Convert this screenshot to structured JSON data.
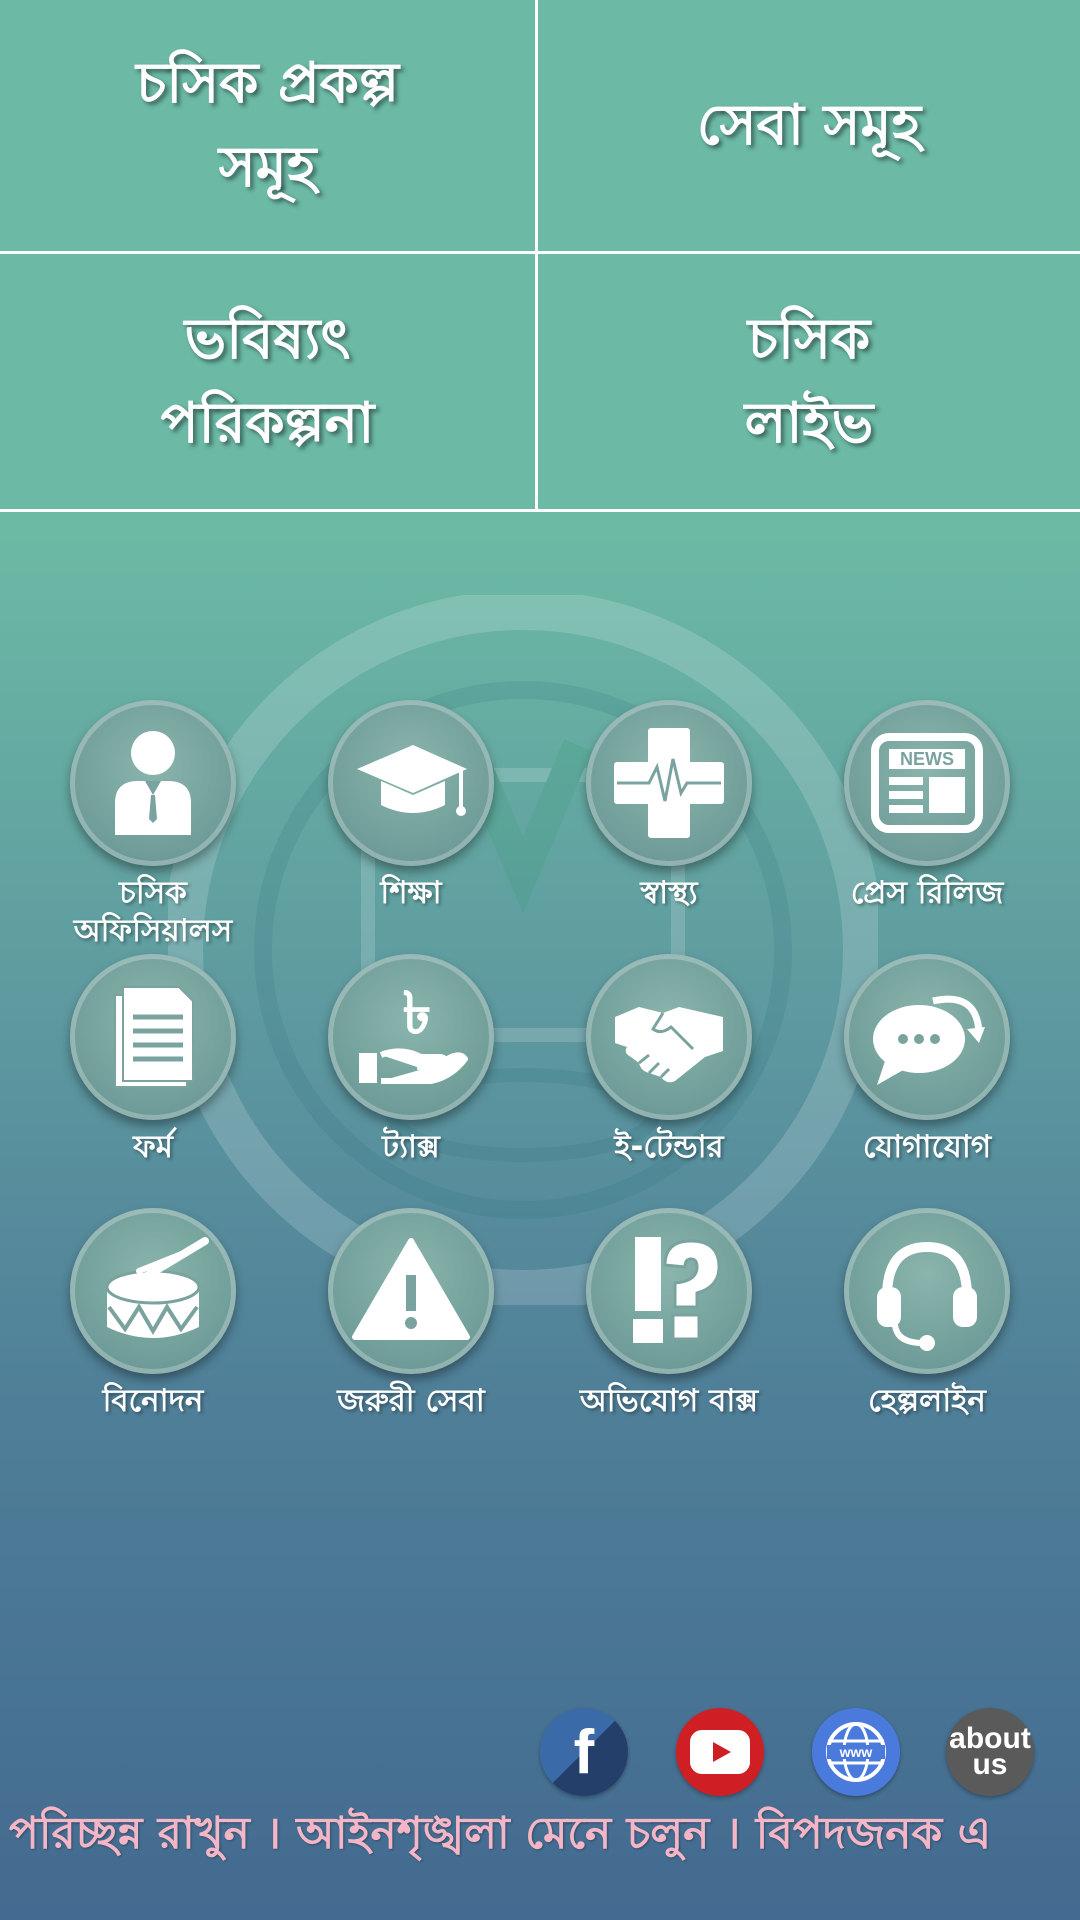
{
  "tiles": [
    {
      "label": "চসিক প্রকল্প\nসমূহ"
    },
    {
      "label": "সেবা সমূহ"
    },
    {
      "label": "ভবিষ্যৎ\nপরিকল্পনা"
    },
    {
      "label": "চসিক\nলাইভ"
    }
  ],
  "services": [
    {
      "label": "চসিক\nঅফিসিয়ালস",
      "icon": "official-person-icon"
    },
    {
      "label": "শিক্ষা",
      "icon": "graduation-cap-icon"
    },
    {
      "label": "স্বাস্থ্য",
      "icon": "health-cross-icon"
    },
    {
      "label": "প্রেস রিলিজ",
      "icon": "newspaper-icon"
    },
    {
      "label": "ফর্ম",
      "icon": "document-icon"
    },
    {
      "label": "ট্যাক্স",
      "icon": "taka-hand-icon"
    },
    {
      "label": "ই-টেন্ডার",
      "icon": "handshake-icon"
    },
    {
      "label": "যোগাযোগ",
      "icon": "chat-bubble-icon"
    },
    {
      "label": "বিনোদন",
      "icon": "drum-icon"
    },
    {
      "label": "জরুরী সেবা",
      "icon": "warning-icon"
    },
    {
      "label": "অভিযোগ বাক্স",
      "icon": "question-icon"
    },
    {
      "label": "হেল্পলাইন",
      "icon": "headset-icon"
    }
  ],
  "social": {
    "facebook": "f",
    "about_line1": "about",
    "about_line2": "us"
  },
  "marquee": "। পরিচ্ছন্ন রাখুন । আইনশৃঙ্খলা মেনে চলুন । বিপদজনক এ",
  "colors": {
    "tile_bg": "#6cb9a6",
    "marquee_text": "#f4b6c6",
    "youtube": "#cf1f25",
    "www": "#4a7bdc",
    "facebook": "#3a6aa8",
    "about": "#5a5a5a"
  }
}
